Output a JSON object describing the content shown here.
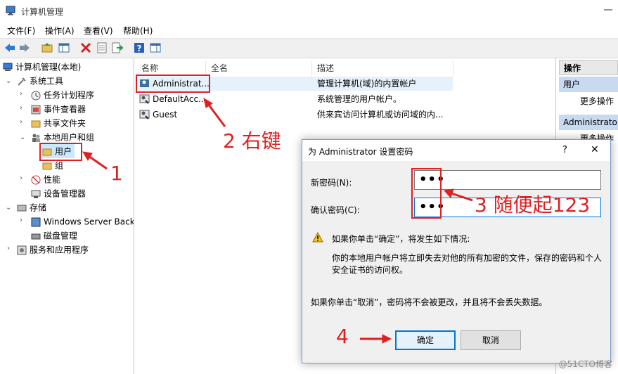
{
  "window": {
    "title": "计算机管理"
  },
  "menu": [
    "文件(F)",
    "操作(A)",
    "查看(V)",
    "帮助(H)"
  ],
  "tree": {
    "root": "计算机管理(本地)",
    "system_tools": "系统工具",
    "task_scheduler": "任务计划程序",
    "event_viewer": "事件查看器",
    "shared_folders": "共享文件夹",
    "local_users": "本地用户和组",
    "users": "用户",
    "groups": "组",
    "performance": "性能",
    "device_manager": "设备管理器",
    "storage": "存储",
    "wsb": "Windows Server Back",
    "disk_mgmt": "磁盘管理",
    "services": "服务和应用程序"
  },
  "list": {
    "columns": [
      "名称",
      "全名",
      "描述"
    ],
    "rows": [
      {
        "name": "Administrat...",
        "fullname": "",
        "desc": "管理计算机(域)的内置帐户"
      },
      {
        "name": "DefaultAcc...",
        "fullname": "",
        "desc": "系统管理的用户帐户。"
      },
      {
        "name": "Guest",
        "fullname": "",
        "desc": "供来宾访问计算机或访问域的内..."
      }
    ]
  },
  "actions": {
    "header": "操作",
    "section1": "用户",
    "more1": "更多操作",
    "section2": "Administrato",
    "more2": "更多操作"
  },
  "dialog": {
    "title": "为 Administrator 设置密码",
    "help": "?",
    "close": "✕",
    "new_pw_label": "新密码(N):",
    "confirm_pw_label": "确认密码(C):",
    "new_pw_value": "•••",
    "confirm_pw_value": "•••",
    "warning_title": "如果你单击“确定”，将发生如下情况:",
    "warning_body": "你的本地用户帐户将立即失去对他的所有加密的文件，保存的密码和个人安全证书的访问权。",
    "cancel_note": "如果你单击“取消”，密码将不会被更改，并且将不会丢失数据。",
    "ok": "确定",
    "cancel": "取消"
  },
  "annotations": {
    "a1": "1",
    "a2": "2 右键",
    "a3": "3 随便起123",
    "a4": "4"
  },
  "watermark": "@51CTO博客",
  "colors": {
    "annotation": "#e02020",
    "selection": "#cce8ff",
    "toolbar": "#f0f0f0"
  }
}
